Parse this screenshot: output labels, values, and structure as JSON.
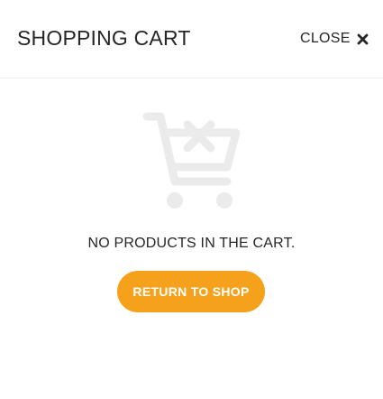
{
  "header": {
    "title": "SHOPPING CART",
    "close_label": "CLOSE",
    "close_icon": "close-icon"
  },
  "empty_state": {
    "icon": "empty-cart-icon",
    "message": "NO PRODUCTS IN THE CART.",
    "return_label": "RETURN TO SHOP"
  },
  "colors": {
    "accent": "#f5a11c",
    "text": "#262626",
    "icon_muted": "#ebebeb",
    "button_text": "#ffffff"
  }
}
